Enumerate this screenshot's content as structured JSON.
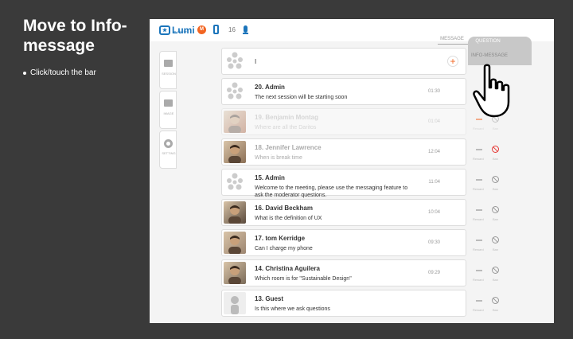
{
  "slide": {
    "title": "Move to Info-message",
    "bullet": "Click/touch the bar"
  },
  "app": {
    "logo": "Lumi",
    "logo_sub": "mobile",
    "count": "16",
    "tab_message": "MESSAGE",
    "tab_question": "QUESTION",
    "info_message": "INFO-MESSAGE",
    "sidebar": [
      {
        "label": "SESSION",
        "icon": "folder-icon"
      },
      {
        "label": "IMAGE",
        "icon": "camera-icon"
      },
      {
        "label": "SETTING",
        "icon": "gear-icon"
      }
    ],
    "input_value": "I",
    "messages": [
      {
        "name": "20. Admin",
        "text": "The next session will be starting soon",
        "time": "01:30",
        "avatar": "lumi",
        "faded": false,
        "actions": false
      },
      {
        "name": "19. Benjamin Montag",
        "text": "Where are all the Daritos",
        "time": "01:04",
        "avatar": "photo",
        "faded": true,
        "actions": true,
        "orange": true
      },
      {
        "name": "18. Jennifer Lawrence",
        "text": "When is break time",
        "time": "12:04",
        "avatar": "photo",
        "faded": false,
        "light": true,
        "actions": true,
        "red": true
      },
      {
        "name": "15. Admin",
        "text": "Welcome to the meeting, please use the messaging feature to ask the moderator questions.",
        "time": "11:04",
        "avatar": "lumi",
        "faded": false,
        "actions": true
      },
      {
        "name": "16. David Beckham",
        "text": "What is the definition of UX",
        "time": "10:04",
        "avatar": "photo",
        "faded": false,
        "actions": true
      },
      {
        "name": "17. tom Kerridge",
        "text": "Can I charge my phone",
        "time": "09:30",
        "avatar": "photo",
        "faded": false,
        "actions": true
      },
      {
        "name": "14. Christina Aguilera",
        "text": "Which room is for \"Sustainable Design\"",
        "time": "09:29",
        "avatar": "photo",
        "faded": false,
        "actions": true
      },
      {
        "name": "13. Guest",
        "text": "Is this where we ask questions",
        "time": "",
        "avatar": "guest",
        "faded": false,
        "actions": true
      }
    ],
    "action_labels": {
      "reward": "Reward",
      "ban": "Ban"
    }
  },
  "colors": {
    "accent": "#1b75bb",
    "orange": "#f26522",
    "red": "#e53935"
  }
}
